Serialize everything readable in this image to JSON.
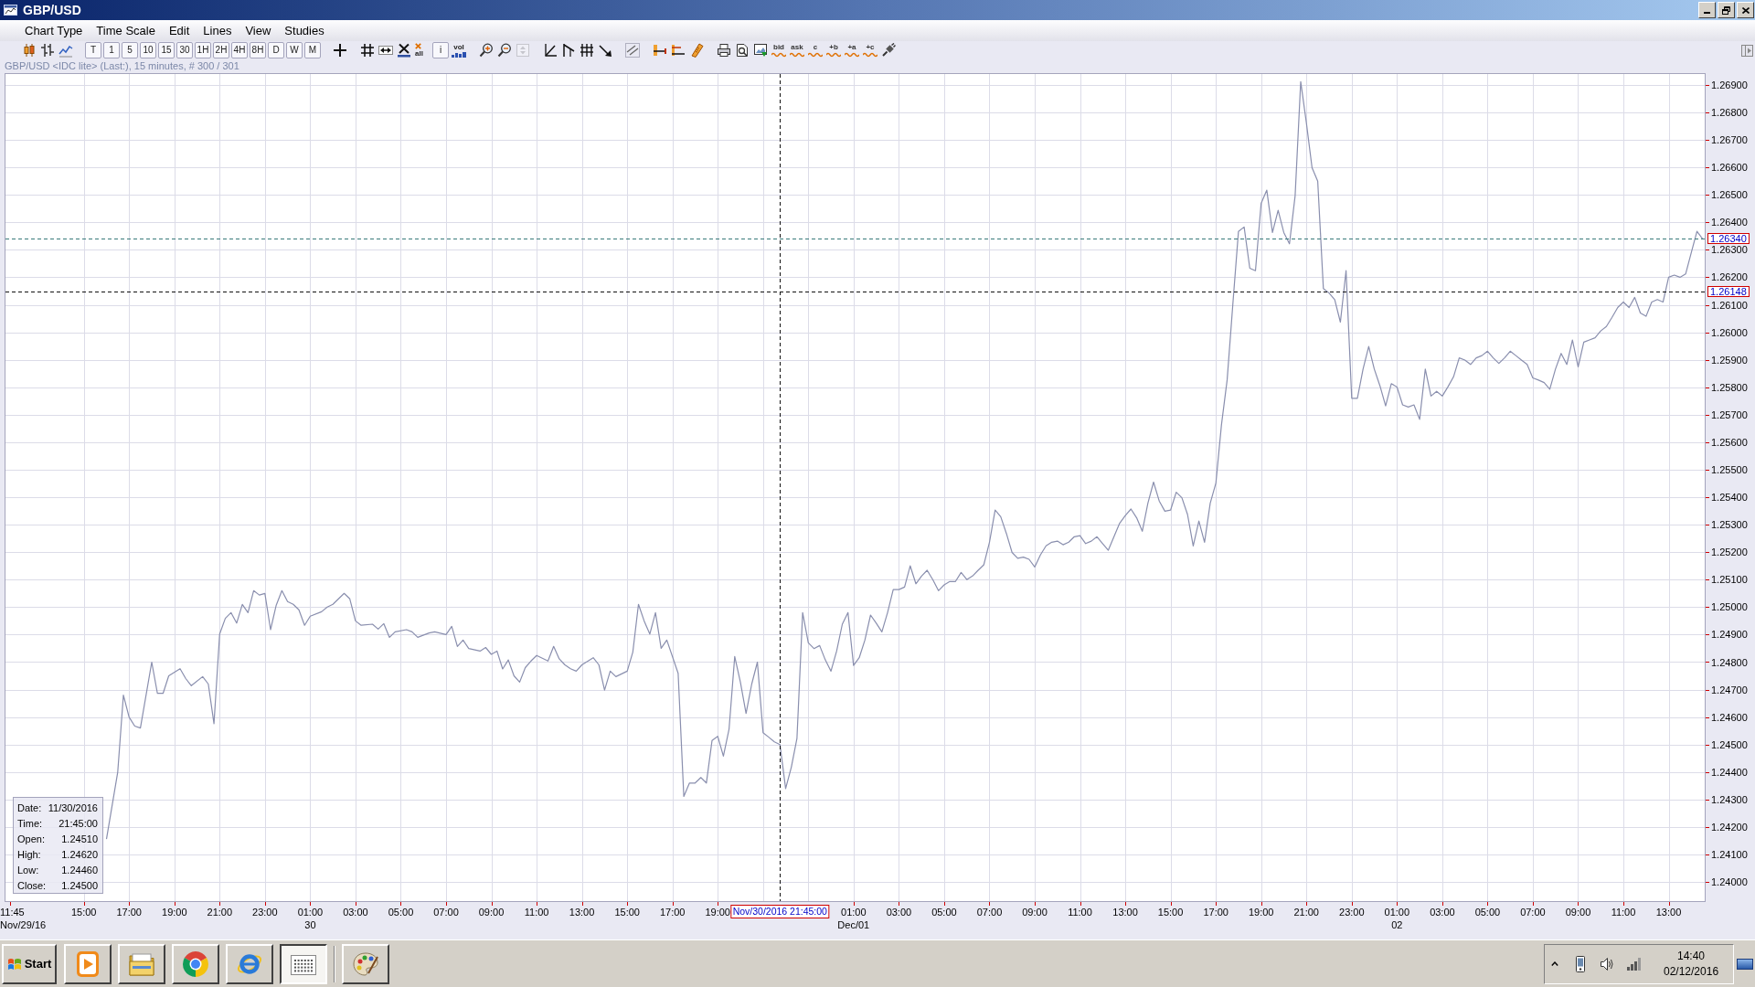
{
  "window": {
    "title": "GBP/USD"
  },
  "menu": [
    "Chart Type",
    "Time Scale",
    "Edit",
    "Lines",
    "View",
    "Studies"
  ],
  "toolbar": [
    [
      {
        "kind": "icon",
        "disabled": false
      },
      {
        "kind": "icon",
        "disabled": false
      },
      {
        "kind": "icon",
        "disabled": false
      }
    ],
    [
      {
        "kind": "text",
        "label": "T",
        "disabled": false
      },
      {
        "kind": "text",
        "label": "1",
        "disabled": false
      },
      {
        "kind": "text",
        "label": "5",
        "disabled": false
      },
      {
        "kind": "text",
        "label": "10",
        "disabled": false
      },
      {
        "kind": "text",
        "label": "15",
        "disabled": false
      },
      {
        "kind": "text",
        "label": "30",
        "disabled": false
      },
      {
        "kind": "text",
        "label": "1H",
        "disabled": false
      },
      {
        "kind": "text",
        "label": "2H",
        "disabled": false
      },
      {
        "kind": "text",
        "label": "4H",
        "disabled": false
      },
      {
        "kind": "text",
        "label": "8H",
        "disabled": false
      },
      {
        "kind": "text",
        "label": "D",
        "disabled": false
      },
      {
        "kind": "text",
        "label": "W",
        "disabled": false
      },
      {
        "kind": "text",
        "label": "M",
        "disabled": false
      }
    ],
    [
      {
        "kind": "icon",
        "disabled": false
      }
    ],
    [
      {
        "kind": "icon",
        "disabled": false
      },
      {
        "kind": "icon",
        "disabled": false
      },
      {
        "kind": "icon",
        "disabled": false
      },
      {
        "kind": "x-label",
        "label": "all",
        "disabled": false
      },
      {
        "kind": "text",
        "label": "i",
        "disabled": false
      },
      {
        "kind": "bars-label",
        "label": "vol",
        "disabled": false
      }
    ],
    [
      {
        "kind": "icon",
        "disabled": false
      },
      {
        "kind": "icon",
        "disabled": false
      },
      {
        "kind": "icon",
        "disabled": true
      }
    ],
    [
      {
        "kind": "icon",
        "disabled": false
      },
      {
        "kind": "icon",
        "disabled": false
      },
      {
        "kind": "icon",
        "disabled": false
      },
      {
        "kind": "icon",
        "disabled": false
      }
    ],
    [
      {
        "kind": "icon",
        "disabled": false
      }
    ],
    [
      {
        "kind": "icon",
        "disabled": false
      },
      {
        "kind": "icon",
        "disabled": false
      },
      {
        "kind": "icon",
        "disabled": false
      }
    ],
    [
      {
        "kind": "icon",
        "disabled": false
      },
      {
        "kind": "icon",
        "disabled": false
      },
      {
        "kind": "icon",
        "disabled": false
      },
      {
        "kind": "wave-label",
        "label": "bid",
        "disabled": false
      },
      {
        "kind": "wave-label",
        "label": "ask",
        "disabled": false
      },
      {
        "kind": "wave-label",
        "label": "c",
        "disabled": false
      },
      {
        "kind": "wave-label",
        "label": "+b",
        "disabled": false
      },
      {
        "kind": "wave-label",
        "label": "+a",
        "disabled": false
      },
      {
        "kind": "wave-label",
        "label": "+c",
        "disabled": false
      },
      {
        "kind": "icon",
        "disabled": false
      }
    ]
  ],
  "chart": {
    "info_line": "GBP/USD <IDC lite> (Last:), 15 minutes, # 300 / 301",
    "chart_data": {
      "type": "line",
      "grid": true,
      "xlim": [
        "2016-11-29T11:30",
        "2016-12-02T14:38"
      ],
      "ylim": [
        1.23927,
        1.26943
      ],
      "x": [
        "2016-11-29T16:00",
        "2016-11-29T16:30",
        "2016-11-29T16:45",
        "2016-11-29T17:00",
        "2016-11-29T17:15",
        "2016-11-29T17:30",
        "2016-11-29T17:45",
        "2016-11-29T18:00",
        "2016-11-29T18:15",
        "2016-11-29T18:30",
        "2016-11-29T18:45",
        "2016-11-29T19:15",
        "2016-11-29T19:30",
        "2016-11-29T19:45",
        "2016-11-29T20:15",
        "2016-11-29T20:30",
        "2016-11-29T20:45",
        "2016-11-29T21:00",
        "2016-11-29T21:15",
        "2016-11-29T21:30",
        "2016-11-29T21:45",
        "2016-11-29T22:00",
        "2016-11-29T22:15",
        "2016-11-29T22:30",
        "2016-11-29T22:45",
        "2016-11-29T23:00",
        "2016-11-29T23:15",
        "2016-11-29T23:30",
        "2016-11-29T23:45",
        "2016-11-30T00:00",
        "2016-11-30T00:15",
        "2016-11-30T00:30",
        "2016-11-30T00:45",
        "2016-11-30T01:00",
        "2016-11-30T01:30",
        "2016-11-30T01:45",
        "2016-11-30T02:00",
        "2016-11-30T02:30",
        "2016-11-30T02:45",
        "2016-11-30T03:00",
        "2016-11-30T03:15",
        "2016-11-30T03:45",
        "2016-11-30T04:00",
        "2016-11-30T04:15",
        "2016-11-30T04:30",
        "2016-11-30T04:45",
        "2016-11-30T05:15",
        "2016-11-30T05:30",
        "2016-11-30T05:45",
        "2016-11-30T06:15",
        "2016-11-30T06:30",
        "2016-11-30T07:00",
        "2016-11-30T07:15",
        "2016-11-30T07:30",
        "2016-11-30T07:45",
        "2016-11-30T08:00",
        "2016-11-30T08:30",
        "2016-11-30T08:45",
        "2016-11-30T09:00",
        "2016-11-30T09:15",
        "2016-11-30T09:30",
        "2016-11-30T09:45",
        "2016-11-30T10:00",
        "2016-11-30T10:15",
        "2016-11-30T10:30",
        "2016-11-30T10:45",
        "2016-11-30T11:00",
        "2016-11-30T11:30",
        "2016-11-30T11:45",
        "2016-11-30T12:00",
        "2016-11-30T12:15",
        "2016-11-30T12:30",
        "2016-11-30T12:45",
        "2016-11-30T13:00",
        "2016-11-30T13:30",
        "2016-11-30T13:45",
        "2016-11-30T14:00",
        "2016-11-30T14:15",
        "2016-11-30T14:30",
        "2016-11-30T15:00",
        "2016-11-30T15:15",
        "2016-11-30T15:30",
        "2016-11-30T15:45",
        "2016-11-30T16:00",
        "2016-11-30T16:15",
        "2016-11-30T16:30",
        "2016-11-30T16:45",
        "2016-11-30T17:15",
        "2016-11-30T17:30",
        "2016-11-30T17:45",
        "2016-11-30T18:00",
        "2016-11-30T18:15",
        "2016-11-30T18:30",
        "2016-11-30T18:45",
        "2016-11-30T19:00",
        "2016-11-30T19:15",
        "2016-11-30T19:30",
        "2016-11-30T19:45",
        "2016-11-30T20:00",
        "2016-11-30T20:15",
        "2016-11-30T20:30",
        "2016-11-30T20:45",
        "2016-11-30T21:00",
        "2016-11-30T21:15",
        "2016-11-30T21:30",
        "2016-11-30T21:45",
        "2016-11-30T22:00",
        "2016-11-30T22:15",
        "2016-11-30T22:30",
        "2016-11-30T22:45",
        "2016-11-30T23:00",
        "2016-11-30T23:15",
        "2016-11-30T23:30",
        "2016-11-30T23:45",
        "2016-12-01T00:00",
        "2016-12-01T00:15",
        "2016-12-01T00:30",
        "2016-12-01T00:45",
        "2016-12-01T01:00",
        "2016-12-01T01:15",
        "2016-12-01T01:30",
        "2016-12-01T01:45",
        "2016-12-01T02:00",
        "2016-12-01T02:15",
        "2016-12-01T02:30",
        "2016-12-01T02:45",
        "2016-12-01T03:00",
        "2016-12-01T03:15",
        "2016-12-01T03:30",
        "2016-12-01T03:45",
        "2016-12-01T04:00",
        "2016-12-01T04:15",
        "2016-12-01T04:30",
        "2016-12-01T04:45",
        "2016-12-01T05:00",
        "2016-12-01T05:15",
        "2016-12-01T05:30",
        "2016-12-01T05:45",
        "2016-12-01T06:00",
        "2016-12-01T06:15",
        "2016-12-01T06:30",
        "2016-12-01T06:45",
        "2016-12-01T07:00",
        "2016-12-01T07:15",
        "2016-12-01T07:30",
        "2016-12-01T07:45",
        "2016-12-01T08:00",
        "2016-12-01T08:15",
        "2016-12-01T08:30",
        "2016-12-01T08:45",
        "2016-12-01T09:00",
        "2016-12-01T09:15",
        "2016-12-01T09:30",
        "2016-12-01T09:45",
        "2016-12-01T10:00",
        "2016-12-01T10:15",
        "2016-12-01T10:30",
        "2016-12-01T10:45",
        "2016-12-01T11:00",
        "2016-12-01T11:15",
        "2016-12-01T11:30",
        "2016-12-01T11:45",
        "2016-12-01T12:00",
        "2016-12-01T12:15",
        "2016-12-01T12:30",
        "2016-12-01T12:45",
        "2016-12-01T13:00",
        "2016-12-01T13:15",
        "2016-12-01T13:30",
        "2016-12-01T13:45",
        "2016-12-01T14:00",
        "2016-12-01T14:15",
        "2016-12-01T14:30",
        "2016-12-01T14:45",
        "2016-12-01T15:00",
        "2016-12-01T15:15",
        "2016-12-01T15:30",
        "2016-12-01T15:45",
        "2016-12-01T16:00",
        "2016-12-01T16:15",
        "2016-12-01T16:30",
        "2016-12-01T16:45",
        "2016-12-01T17:00",
        "2016-12-01T17:15",
        "2016-12-01T17:30",
        "2016-12-01T17:45",
        "2016-12-01T18:00",
        "2016-12-01T18:15",
        "2016-12-01T18:30",
        "2016-12-01T18:45",
        "2016-12-01T19:00",
        "2016-12-01T19:15",
        "2016-12-01T19:30",
        "2016-12-01T19:45",
        "2016-12-01T20:00",
        "2016-12-01T20:15",
        "2016-12-01T20:30",
        "2016-12-01T20:45",
        "2016-12-01T21:00",
        "2016-12-01T21:15",
        "2016-12-01T21:30",
        "2016-12-01T21:45",
        "2016-12-01T22:00",
        "2016-12-01T22:15",
        "2016-12-01T22:30",
        "2016-12-01T22:45",
        "2016-12-01T23:00",
        "2016-12-01T23:15",
        "2016-12-01T23:30",
        "2016-12-01T23:45",
        "2016-12-02T00:00",
        "2016-12-02T00:15",
        "2016-12-02T00:30",
        "2016-12-02T00:45",
        "2016-12-02T01:00",
        "2016-12-02T01:15",
        "2016-12-02T01:30",
        "2016-12-02T01:45",
        "2016-12-02T02:00",
        "2016-12-02T02:15",
        "2016-12-02T02:30",
        "2016-12-02T02:45",
        "2016-12-02T03:00",
        "2016-12-02T03:15",
        "2016-12-02T03:30",
        "2016-12-02T03:45",
        "2016-12-02T04:00",
        "2016-12-02T04:15",
        "2016-12-02T04:30",
        "2016-12-02T04:45",
        "2016-12-02T05:00",
        "2016-12-02T05:15",
        "2016-12-02T05:30",
        "2016-12-02T05:45",
        "2016-12-02T06:00",
        "2016-12-02T06:15",
        "2016-12-02T06:30",
        "2016-12-02T06:45",
        "2016-12-02T07:00",
        "2016-12-02T07:15",
        "2016-12-02T07:30",
        "2016-12-02T07:45",
        "2016-12-02T08:00",
        "2016-12-02T08:15",
        "2016-12-02T08:30",
        "2016-12-02T08:45",
        "2016-12-02T09:00",
        "2016-12-02T09:15",
        "2016-12-02T09:30",
        "2016-12-02T09:45",
        "2016-12-02T10:00",
        "2016-12-02T10:15",
        "2016-12-02T10:30",
        "2016-12-02T10:45",
        "2016-12-02T11:00",
        "2016-12-02T11:15",
        "2016-12-02T11:30",
        "2016-12-02T11:45",
        "2016-12-02T12:00",
        "2016-12-02T12:15",
        "2016-12-02T12:30",
        "2016-12-02T12:45",
        "2016-12-02T13:00",
        "2016-12-02T13:15",
        "2016-12-02T13:30",
        "2016-12-02T13:45",
        "2016-12-02T14:00",
        "2016-12-02T14:15",
        "2016-12-02T14:30"
      ],
      "series": [
        {
          "color": "#8a8fae",
          "values": [
            1.24156,
            1.244,
            1.2468,
            1.246,
            1.24567,
            1.2456,
            1.2468,
            1.248,
            1.24686,
            1.24686,
            1.2475,
            1.24776,
            1.2474,
            1.24714,
            1.24747,
            1.2472,
            1.24576,
            1.24902,
            1.24959,
            1.2498,
            1.24942,
            1.2501,
            1.2498,
            1.2506,
            1.25044,
            1.2505,
            1.24918,
            1.25007,
            1.2506,
            1.2502,
            1.2501,
            1.2499,
            1.24934,
            1.24967,
            1.24983,
            1.25,
            1.2501,
            1.2505,
            1.2503,
            1.2495,
            1.24934,
            1.24938,
            1.2492,
            1.2494,
            1.2489,
            1.2491,
            1.24918,
            1.2491,
            1.2489,
            1.24906,
            1.2491,
            1.249,
            1.2493,
            1.24857,
            1.2488,
            1.24849,
            1.2484,
            1.24853,
            1.24828,
            1.2484,
            1.24775,
            1.24808,
            1.2475,
            1.24727,
            1.2478,
            1.24804,
            1.24824,
            1.24804,
            1.24857,
            1.24812,
            1.2479,
            1.24776,
            1.24767,
            1.2479,
            1.24816,
            1.2479,
            1.24698,
            1.24767,
            1.24747,
            1.24767,
            1.24836,
            1.2501,
            1.2495,
            1.24902,
            1.2498,
            1.2485,
            1.2488,
            1.24759,
            1.24311,
            1.2436,
            1.2436,
            1.2438,
            1.2436,
            1.24515,
            1.2453,
            1.24458,
            1.24556,
            1.2482,
            1.24727,
            1.24613,
            1.2472,
            1.248,
            1.24543,
            1.24527,
            1.2451,
            1.245,
            1.2434,
            1.24417,
            1.24523,
            1.2498,
            1.2487,
            1.24849,
            1.2486,
            1.24808,
            1.24767,
            1.2484,
            1.24938,
            1.2498,
            1.24788,
            1.24816,
            1.2488,
            1.24971,
            1.24942,
            1.2491,
            1.2498,
            1.25064,
            1.25064,
            1.25073,
            1.2515,
            1.25085,
            1.25113,
            1.25134,
            1.251,
            1.2506,
            1.25081,
            1.25093,
            1.25093,
            1.25126,
            1.251,
            1.25113,
            1.25134,
            1.25154,
            1.25236,
            1.25353,
            1.25329,
            1.25268,
            1.25199,
            1.25178,
            1.25182,
            1.25174,
            1.25146,
            1.2519,
            1.25223,
            1.25236,
            1.2524,
            1.25227,
            1.25236,
            1.25256,
            1.2526,
            1.25231,
            1.2524,
            1.25256,
            1.25231,
            1.25207,
            1.25256,
            1.25305,
            1.25333,
            1.25357,
            1.25325,
            1.25276,
            1.25378,
            1.25455,
            1.25386,
            1.25349,
            1.25353,
            1.25418,
            1.25398,
            1.25337,
            1.25223,
            1.25313,
            1.25236,
            1.25378,
            1.25451,
            1.25663,
            1.25826,
            1.261,
            1.26367,
            1.26383,
            1.26233,
            1.26224,
            1.26469,
            1.26517,
            1.26363,
            1.26444,
            1.26363,
            1.26322,
            1.26497,
            1.26912,
            1.26762,
            1.26599,
            1.2655,
            1.26159,
            1.26143,
            1.26119,
            1.26037,
            1.26224,
            1.2576,
            1.2576,
            1.25866,
            1.25948,
            1.25866,
            1.25805,
            1.25732,
            1.25813,
            1.25801,
            1.25736,
            1.25728,
            1.25736,
            1.25683,
            1.25866,
            1.25768,
            1.25785,
            1.25768,
            1.25801,
            1.25838,
            1.25907,
            1.25899,
            1.25883,
            1.25907,
            1.25915,
            1.25931,
            1.25907,
            1.25887,
            1.25907,
            1.25931,
            1.25915,
            1.25899,
            1.25883,
            1.25834,
            1.25826,
            1.25817,
            1.25793,
            1.25866,
            1.25923,
            1.25883,
            1.25972,
            1.25874,
            1.25964,
            1.25972,
            1.2598,
            1.26005,
            1.26021,
            1.26054,
            1.2609,
            1.2611,
            1.2609,
            1.26127,
            1.2607,
            1.26058,
            1.2611,
            1.26119,
            1.2611,
            1.262,
            1.26208,
            1.262,
            1.26212,
            1.2629,
            1.26367,
            1.2634
          ]
        }
      ],
      "xticks": [
        {
          "value": "2016-11-29T11:45",
          "label": "11:45"
        },
        {
          "value": "2016-11-29T15:00",
          "label": "15:00"
        },
        {
          "value": "2016-11-29T17:00",
          "label": "17:00"
        },
        {
          "value": "2016-11-29T19:00",
          "label": "19:00"
        },
        {
          "value": "2016-11-29T21:00",
          "label": "21:00"
        },
        {
          "value": "2016-11-29T23:00",
          "label": "23:00"
        },
        {
          "value": "2016-11-30T01:00",
          "label": "01:00\n30"
        },
        {
          "value": "2016-11-30T03:00",
          "label": "03:00"
        },
        {
          "value": "2016-11-30T05:00",
          "label": "05:00"
        },
        {
          "value": "2016-11-30T07:00",
          "label": "07:00"
        },
        {
          "value": "2016-11-30T09:00",
          "label": "09:00"
        },
        {
          "value": "2016-11-30T11:00",
          "label": "11:00"
        },
        {
          "value": "2016-11-30T13:00",
          "label": "13:00"
        },
        {
          "value": "2016-11-30T15:00",
          "label": "15:00"
        },
        {
          "value": "2016-11-30T17:00",
          "label": "17:00"
        },
        {
          "value": "2016-11-30T19:00",
          "label": "19:00"
        },
        {
          "value": "2016-12-01T01:00",
          "label": "01:00\nDec/01"
        },
        {
          "value": "2016-12-01T03:00",
          "label": "03:00"
        },
        {
          "value": "2016-12-01T05:00",
          "label": "05:00"
        },
        {
          "value": "2016-12-01T07:00",
          "label": "07:00"
        },
        {
          "value": "2016-12-01T09:00",
          "label": "09:00"
        },
        {
          "value": "2016-12-01T11:00",
          "label": "11:00"
        },
        {
          "value": "2016-12-01T13:00",
          "label": "13:00"
        },
        {
          "value": "2016-12-01T15:00",
          "label": "15:00"
        },
        {
          "value": "2016-12-01T17:00",
          "label": "17:00"
        },
        {
          "value": "2016-12-01T19:00",
          "label": "19:00"
        },
        {
          "value": "2016-12-01T21:00",
          "label": "21:00"
        },
        {
          "value": "2016-12-01T23:00",
          "label": "23:00"
        },
        {
          "value": "2016-12-02T01:00",
          "label": "01:00\n02"
        },
        {
          "value": "2016-12-02T03:00",
          "label": "03:00"
        },
        {
          "value": "2016-12-02T05:00",
          "label": "05:00"
        },
        {
          "value": "2016-12-02T07:00",
          "label": "07:00"
        },
        {
          "value": "2016-12-02T09:00",
          "label": "09:00"
        },
        {
          "value": "2016-12-02T11:00",
          "label": "11:00"
        },
        {
          "value": "2016-12-02T13:00",
          "label": "13:00"
        }
      ],
      "yticks": [
        {
          "value": 1.24,
          "label": "1.24000"
        },
        {
          "value": 1.241,
          "label": "1.24100"
        },
        {
          "value": 1.242,
          "label": "1.24200"
        },
        {
          "value": 1.243,
          "label": "1.24300"
        },
        {
          "value": 1.244,
          "label": "1.24400"
        },
        {
          "value": 1.245,
          "label": "1.24500"
        },
        {
          "value": 1.246,
          "label": "1.24600"
        },
        {
          "value": 1.247,
          "label": "1.24700"
        },
        {
          "value": 1.248,
          "label": "1.24800"
        },
        {
          "value": 1.249,
          "label": "1.24900"
        },
        {
          "value": 1.25,
          "label": "1.25000"
        },
        {
          "value": 1.251,
          "label": "1.25100"
        },
        {
          "value": 1.252,
          "label": "1.25200"
        },
        {
          "value": 1.253,
          "label": "1.25300"
        },
        {
          "value": 1.254,
          "label": "1.25400"
        },
        {
          "value": 1.255,
          "label": "1.25500"
        },
        {
          "value": 1.256,
          "label": "1.25600"
        },
        {
          "value": 1.257,
          "label": "1.25700"
        },
        {
          "value": 1.258,
          "label": "1.25800"
        },
        {
          "value": 1.259,
          "label": "1.25900"
        },
        {
          "value": 1.26,
          "label": "1.26000"
        },
        {
          "value": 1.261,
          "label": "1.26100"
        },
        {
          "value": 1.262,
          "label": "1.26200"
        },
        {
          "value": 1.263,
          "label": "1.26300"
        },
        {
          "value": 1.264,
          "label": "1.26400"
        },
        {
          "value": 1.265,
          "label": "1.26500"
        },
        {
          "value": 1.266,
          "label": "1.26600"
        },
        {
          "value": 1.267,
          "label": "1.26700"
        },
        {
          "value": 1.268,
          "label": "1.26800"
        },
        {
          "value": 1.269,
          "label": "1.26900"
        }
      ],
      "ref_lines": [
        {
          "axis": "y",
          "value": 1.2634,
          "label": "1.26340",
          "color": "#3a7a7a"
        },
        {
          "axis": "x",
          "value": "2016-11-30T21:45",
          "label": "Nov/30/2016 21:45:00",
          "color": "#111111"
        },
        {
          "axis": "y",
          "value": 1.26148,
          "label": "1.26148",
          "color": "#111111"
        }
      ]
    },
    "start_date_label": "Nov/29/16",
    "data_window": [
      {
        "label": "Date:",
        "value": "11/30/2016"
      },
      {
        "label": "Time:",
        "value": "21:45:00"
      },
      {
        "label": "Open:",
        "value": "1.24510"
      },
      {
        "label": "High:",
        "value": "1.24620"
      },
      {
        "label": "Low:",
        "value": "1.24460"
      },
      {
        "label": "Close:",
        "value": "1.24500"
      }
    ]
  },
  "taskbar": {
    "start": "Start",
    "apps": [
      {
        "selected": false
      },
      {
        "selected": false
      },
      {
        "selected": false
      },
      {
        "selected": false
      },
      {
        "selected": true
      },
      {
        "selected": false
      }
    ],
    "clock": {
      "time": "14:40",
      "date": "02/12/2016"
    }
  }
}
